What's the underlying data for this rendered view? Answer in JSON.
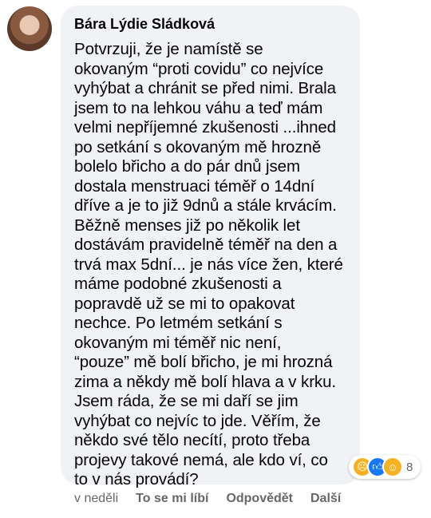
{
  "comment": {
    "author": "Bára Lýdie Sládková",
    "text": "Potvrzuji, že je namístě se\nokovaným “proti covidu” co nejvíce\nvyhýbat a chránit se před nimi. Brala\njsem to na lehkou váhu a teď mám\nvelmi nepříjemné zkušenosti ...ihned\npo setkání s okovaným mě hrozně\nbolelo břicho a do pár dnů jsem\ndostala menstruaci téměř o 14dní\ndříve a je to již 9dnů a stále krvácím.\nBěžně menses již po několik let\ndostávám pravidelně téměř na den a\ntrvá max 5dní... je nás více žen, které\nmáme podobné zkušenosti a\npopravdě už se mi to opakovat\nnechce. Po letmém setkání s\nokovaným mi téměř nic není,\n“pouze” mě bolí břicho, je mi hrozná\nzima a někdy mě bolí hlava a v krku.\nJsem ráda, že se mi daří se jim\nvyhýbat co nejvíc to jde. Věřím, že\nněkdo své tělo necítí, proto třeba\nprojevy takové nemá, ale kdo ví, co\nto v nás provádí?",
    "reactions": {
      "icons": [
        "sad-icon",
        "like-icon",
        "haha-icon"
      ],
      "count": "8"
    }
  },
  "actions": {
    "time": "v neděli",
    "like": "To se mi líbí",
    "reply": "Odpovědět",
    "more": "Další"
  }
}
